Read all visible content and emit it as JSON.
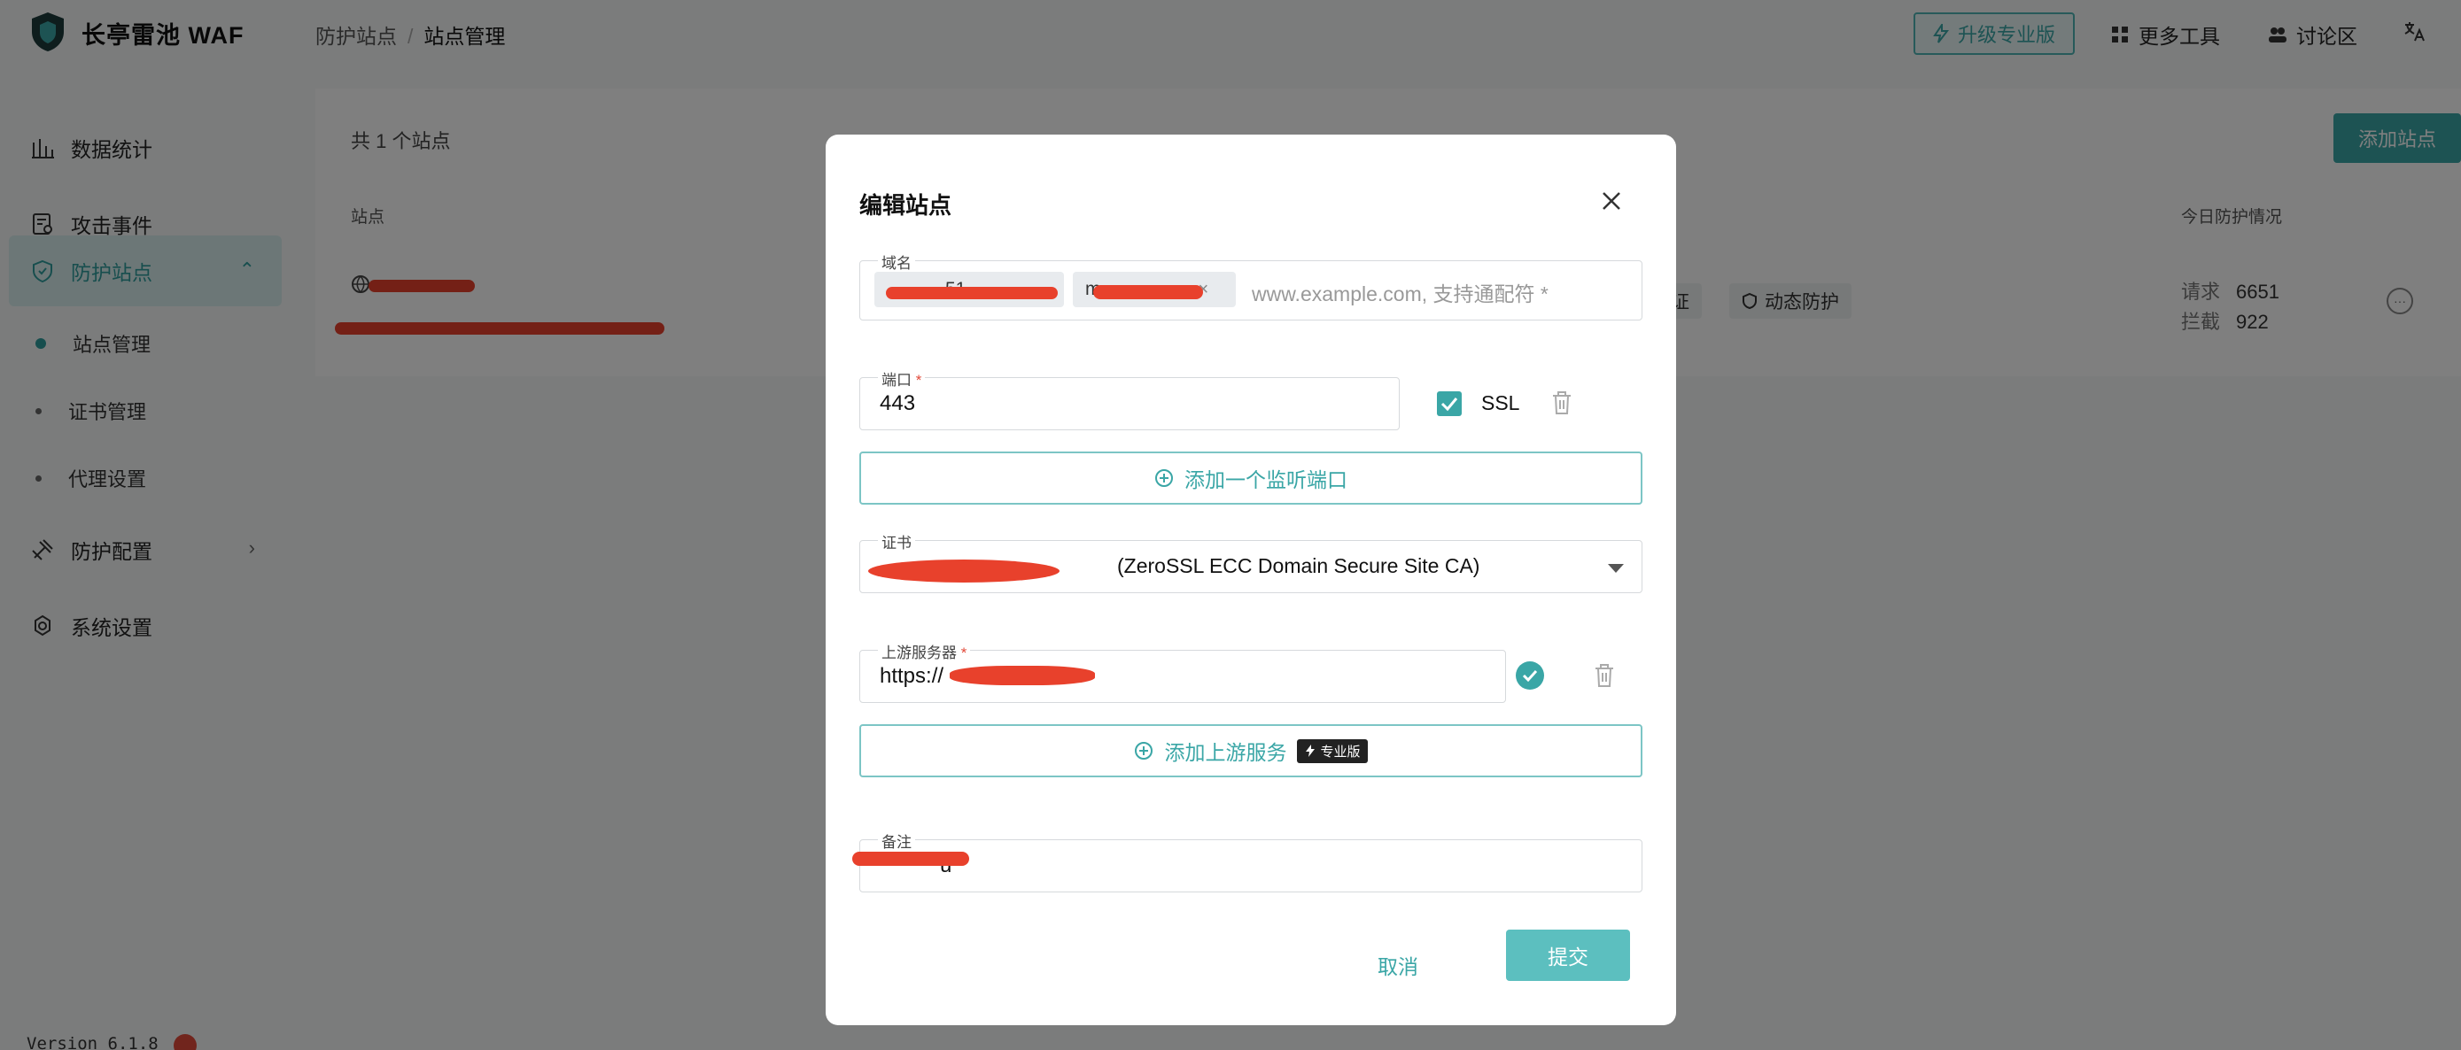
{
  "app": {
    "brand": "长亭雷池 WAF",
    "version": "Version 6.1.8"
  },
  "breadcrumb": {
    "parent": "防护站点",
    "separator": "/",
    "current": "站点管理"
  },
  "topbar": {
    "upgrade_label": "升级专业版",
    "more_tools": "更多工具",
    "forum": "讨论区"
  },
  "sidebar": {
    "items": [
      {
        "label": "数据统计",
        "icon": "bar-chart-icon"
      },
      {
        "label": "攻击事件",
        "icon": "event-icon"
      },
      {
        "label": "防护站点",
        "icon": "shield-icon"
      },
      {
        "label": "防护配置",
        "icon": "tools-icon"
      },
      {
        "label": "系统设置",
        "icon": "gear-icon"
      }
    ],
    "sub_items": [
      {
        "label": "站点管理"
      },
      {
        "label": "证书管理"
      },
      {
        "label": "代理设置"
      }
    ]
  },
  "main": {
    "count_text": "共 1 个站点",
    "add_site_label": "添加站点",
    "columns": {
      "site": "站点",
      "today": "今日防护情况"
    },
    "row": {
      "tag_partial": "证",
      "tag_dynamic": "动态防护",
      "requests_label": "请求",
      "requests_value": "6651",
      "blocked_label": "拦截",
      "blocked_value": "922"
    }
  },
  "modal": {
    "title": "编辑站点",
    "domain": {
      "label": "域名",
      "chip1_visible": "51",
      "chip2_visible": "m",
      "placeholder": "www.example.com, 支持通配符 *"
    },
    "port": {
      "label": "端口",
      "required_mark": "*",
      "value": "443",
      "ssl_label": "SSL",
      "ssl_checked": true
    },
    "add_port_label": "添加一个监听端口",
    "cert": {
      "label": "证书",
      "visible_value": "(ZeroSSL ECC Domain Secure Site CA)"
    },
    "upstream": {
      "label": "上游服务器",
      "required_mark": "*",
      "visible_value": "https://"
    },
    "add_upstream_label": "添加上游服务",
    "pro_badge": "专业版",
    "remark": {
      "label": "备注",
      "visible_value": "u"
    },
    "cancel_label": "取消",
    "submit_label": "提交"
  },
  "colors": {
    "accent": "#3aa6a6",
    "redaction": "#e8412c",
    "overlay": "rgba(0,0,0,0.5)"
  }
}
